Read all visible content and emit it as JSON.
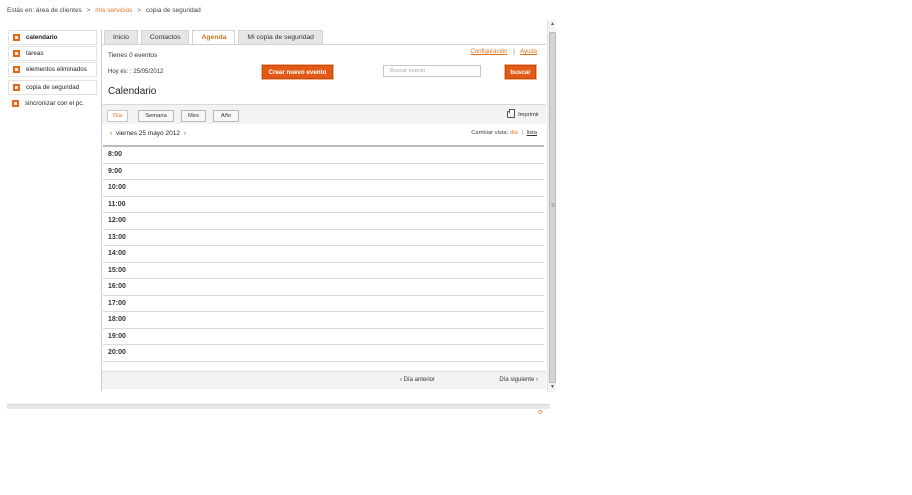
{
  "breadcrumb": {
    "prefix": "Estás en:",
    "items": [
      "área de clientes",
      "mis servicios",
      "copia de seguridad"
    ],
    "separator": ">"
  },
  "sidebar": {
    "items": [
      {
        "label": "calendario",
        "icon": "square-bullet-icon"
      },
      {
        "label": "tareas",
        "icon": "square-bullet-icon"
      },
      {
        "label": "elementos eliminados",
        "icon": "square-bullet-icon"
      },
      {
        "label": "copia de seguridad",
        "icon": "square-bullet-icon"
      },
      {
        "label": "sincronizar con el pc.",
        "icon": "square-bullet-icon"
      }
    ]
  },
  "tabs": [
    "Inicio",
    "Contactos",
    "Agenda",
    "Mi copia de seguridad"
  ],
  "header": {
    "events_count": "Tienes 0 eventos",
    "links": [
      "Configuración",
      "Ayuda"
    ],
    "link_separator": "|",
    "today": "Hoy es: : 25/05/2012",
    "create_button": "Crear nuevo evento",
    "search_placeholder": "Buscar evento",
    "search_button": "buscar"
  },
  "calendar": {
    "title": "Calendario",
    "views": [
      "Día",
      "Semana",
      "Mes",
      "Año"
    ],
    "print_label": "Imprimir",
    "prev_arrow": "‹",
    "next_arrow": "›",
    "date_label": "viernes 25 mayo 2012",
    "view_mode_label": "Cambiar vista:",
    "view_modes": [
      "día",
      "lista"
    ],
    "view_mode_separator": "|",
    "hours": [
      "8:00",
      "9:00",
      "10:00",
      "11:00",
      "12:00",
      "13:00",
      "14:00",
      "15:00",
      "16:00",
      "17:00",
      "18:00",
      "19:00",
      "20:00"
    ],
    "prev_day": "‹ Día anterior",
    "next_day": "Día siguiente ›"
  },
  "colors": {
    "accent": "#e25b16",
    "link": "#e0701a"
  }
}
